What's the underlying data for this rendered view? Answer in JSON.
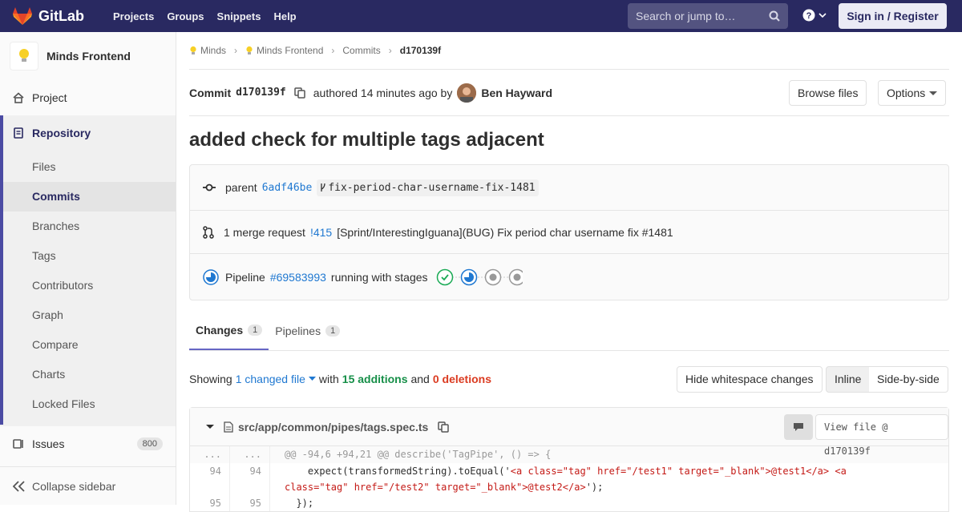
{
  "nav": {
    "brand": "GitLab",
    "links": [
      "Projects",
      "Groups",
      "Snippets",
      "Help"
    ],
    "search_placeholder": "Search or jump to…",
    "signin": "Sign in / Register"
  },
  "sidebar": {
    "project_name": "Minds Frontend",
    "project": "Project",
    "repository": "Repository",
    "repo_items": [
      "Files",
      "Commits",
      "Branches",
      "Tags",
      "Contributors",
      "Graph",
      "Compare",
      "Charts",
      "Locked Files"
    ],
    "issues": "Issues",
    "issues_count": "800",
    "collapse": "Collapse sidebar"
  },
  "breadcrumb": [
    "Minds",
    "Minds Frontend",
    "Commits",
    "d170139f"
  ],
  "commit": {
    "label": "Commit",
    "sha": "d170139f",
    "authored": "authored 14 minutes ago by",
    "author": "Ben Hayward",
    "browse": "Browse files",
    "options": "Options",
    "title": "added check for multiple tags adjacent"
  },
  "info": {
    "parent_label": "parent",
    "parent_sha": "6adf46be",
    "branch": "fix-period-char-username-fix-1481",
    "mr_label": "1 merge request",
    "mr_id": "!415",
    "mr_title": "[Sprint/InterestingIguana](BUG) Fix period char username fix #1481",
    "pipeline_label": "Pipeline",
    "pipeline_id": "#69583993",
    "pipeline_status": "running with stages"
  },
  "tabs": [
    {
      "label": "Changes",
      "count": "1"
    },
    {
      "label": "Pipelines",
      "count": "1"
    }
  ],
  "summary": {
    "showing": "Showing",
    "changed": "1 changed file",
    "with": "with",
    "additions": "15 additions",
    "and": "and",
    "deletions": "0 deletions",
    "hide_ws": "Hide whitespace changes",
    "inline": "Inline",
    "side": "Side-by-side"
  },
  "file": {
    "path": "src/app/common/pipes/tags.spec.ts",
    "view": "View file @ d170139f"
  },
  "diff": {
    "hunk_old": "...",
    "hunk_new": "...",
    "hunk": "@@ -94,6 +94,21 @@ describe('TagPipe', () => {",
    "l1_old": "94",
    "l1_new": "94",
    "l1_pre": "    expect(transformedString).toEqual('",
    "l1_str": "<a class=\"tag\" href=\"/test1\" target=\"_blank\">@test1</a> <a",
    "l1b_str": "class=\"tag\" href=\"/test2\" target=\"_blank\">@test2</a>",
    "l1b_post": "');",
    "l2_old": "95",
    "l2_new": "95",
    "l2": "  });"
  },
  "colors": {
    "nav": "#292961",
    "accent": "#4b4ba3",
    "link": "#1f78d1",
    "green": "#168f48",
    "red": "#db3b21"
  }
}
